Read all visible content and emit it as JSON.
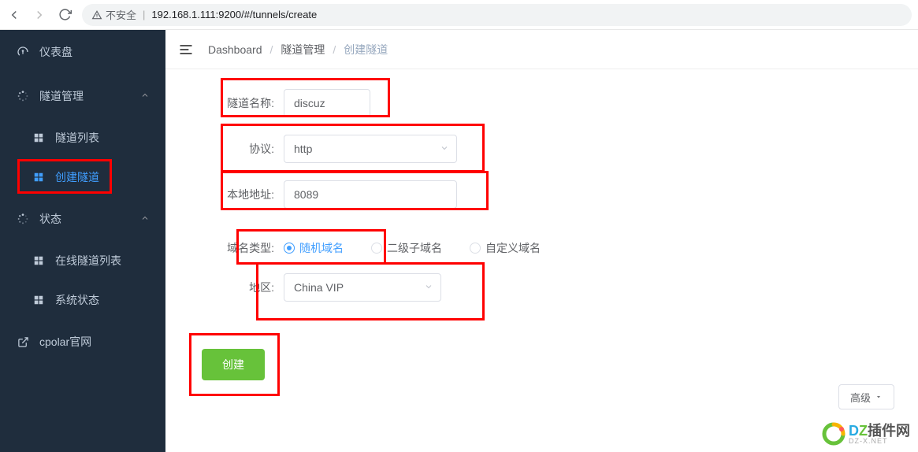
{
  "browser": {
    "insecure_label": "不安全",
    "url": "192.168.1.111:9200/#/tunnels/create"
  },
  "sidebar": {
    "items": [
      {
        "label": "仪表盘",
        "icon": "gauge"
      },
      {
        "label": "隧道管理",
        "icon": "spinner",
        "expand": true
      },
      {
        "label": "隧道列表",
        "icon": "grid",
        "sub": true
      },
      {
        "label": "创建隧道",
        "icon": "grid",
        "sub": true,
        "active": true
      },
      {
        "label": "状态",
        "icon": "spinner",
        "expand": true
      },
      {
        "label": "在线隧道列表",
        "icon": "grid",
        "sub": true
      },
      {
        "label": "系统状态",
        "icon": "grid",
        "sub": true
      },
      {
        "label": "cpolar官网",
        "icon": "external"
      }
    ]
  },
  "breadcrumb": {
    "items": [
      "Dashboard",
      "隧道管理",
      "创建隧道"
    ]
  },
  "form": {
    "tunnel_name_label": "隧道名称:",
    "tunnel_name_value": "discuz",
    "protocol_label": "协议:",
    "protocol_value": "http",
    "local_addr_label": "本地地址:",
    "local_addr_value": "8089",
    "domain_type_label": "域名类型:",
    "domain_options": {
      "random": "随机域名",
      "subdomain": "二级子域名",
      "custom": "自定义域名"
    },
    "region_label": "地区:",
    "region_value": "China VIP",
    "create_button": "创建",
    "advanced_button": "高级"
  },
  "watermark": {
    "main": "DZ插件网",
    "sub": "DZ-X.NET"
  }
}
